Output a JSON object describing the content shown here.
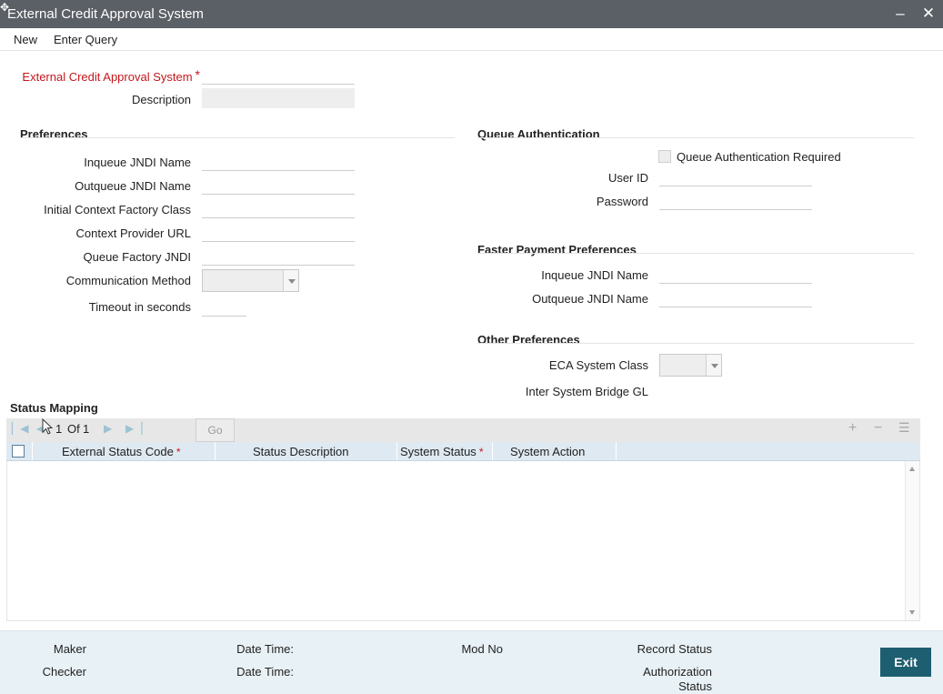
{
  "window": {
    "title": "External Credit Approval System",
    "minimize_glyph": "‒",
    "close_glyph": "✕"
  },
  "menu": {
    "new_label": "New",
    "enter_query_label": "Enter Query"
  },
  "header_fields": {
    "system_label": "External Credit Approval System",
    "system_value": "",
    "description_label": "Description",
    "description_value": ""
  },
  "preferences": {
    "heading": "Preferences",
    "inqueue_jndi_label": "Inqueue JNDI Name",
    "outqueue_jndi_label": "Outqueue JNDI Name",
    "initial_context_label": "Initial Context Factory Class",
    "context_provider_label": "Context Provider URL",
    "queue_factory_label": "Queue Factory JNDI",
    "communication_method_label": "Communication Method",
    "communication_method_value": "",
    "timeout_label": "Timeout in seconds"
  },
  "queue_authentication": {
    "heading": "Queue Authentication",
    "auth_required_label": "Queue Authentication Required",
    "auth_required_checked": false,
    "user_id_label": "User ID",
    "password_label": "Password"
  },
  "faster_payment": {
    "heading": "Faster Payment Preferences",
    "inqueue_jndi_label": "Inqueue JNDI Name",
    "outqueue_jndi_label": "Outqueue JNDI Name"
  },
  "other_preferences": {
    "heading": "Other Preferences",
    "eca_system_class_label": "ECA System Class",
    "eca_system_class_value": "",
    "inter_system_gl_label": "Inter System Bridge GL"
  },
  "status_mapping": {
    "heading": "Status Mapping",
    "pagination": {
      "current": "1",
      "of_label": "Of",
      "total": "1"
    },
    "go_label": "Go",
    "add_glyph": "+",
    "remove_glyph": "−",
    "columns_glyph": "☰",
    "columns": [
      {
        "label": "External Status Code",
        "required": true
      },
      {
        "label": "Status Description",
        "required": false
      },
      {
        "label": "System Status",
        "required": true
      },
      {
        "label": "System Action",
        "required": false
      }
    ],
    "rows": []
  },
  "footer": {
    "maker_label": "Maker",
    "checker_label": "Checker",
    "date_time_label": "Date Time:",
    "mod_no_label": "Mod No",
    "record_status_label": "Record Status",
    "authorization_label_1": "Authorization",
    "authorization_label_2": "Status",
    "exit_label": "Exit"
  },
  "colors": {
    "title_bar": "#5b5f66",
    "required": "#c4161c",
    "footer_bg": "#e8f1f5",
    "exit_button": "#1d5e70",
    "grid_header": "#dfe9f1"
  },
  "icons": [
    "window-move-icon",
    "minimize-icon",
    "close-icon",
    "first-page-icon",
    "prev-page-icon",
    "next-page-icon",
    "last-page-icon",
    "add-row-icon",
    "delete-row-icon",
    "columns-icon",
    "dropdown-arrow-icon"
  ]
}
